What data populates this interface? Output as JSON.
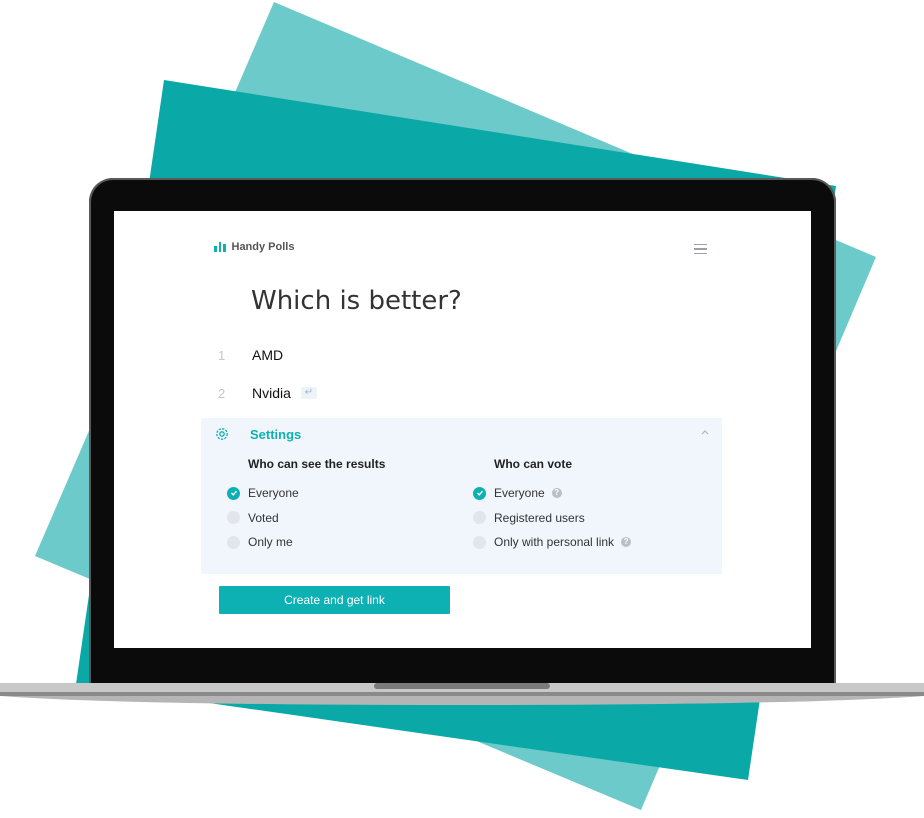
{
  "app": {
    "brand": "Handy Polls"
  },
  "poll": {
    "question": "Which is better?",
    "options": [
      {
        "number": "1",
        "label": "AMD"
      },
      {
        "number": "2",
        "label": "Nvidia"
      }
    ]
  },
  "settings": {
    "title": "Settings",
    "results": {
      "title": "Who can see the results",
      "choices": [
        "Everyone",
        "Voted",
        "Only me"
      ],
      "selected": "Everyone"
    },
    "vote": {
      "title": "Who can vote",
      "choices": [
        "Everyone",
        "Registered users",
        "Only with personal link"
      ],
      "selected": "Everyone",
      "help_glyph": "?"
    }
  },
  "actions": {
    "create_label": "Create and get link"
  },
  "colors": {
    "accent": "#0eb1b3",
    "panel": "#f1f6fc",
    "teal_dark": "#0ba8a8",
    "teal_light": "#6ccacb"
  },
  "icons": [
    "bar-chart-icon",
    "hamburger-menu-icon",
    "enter-key-icon",
    "gear-icon",
    "chevron-up-icon",
    "check-icon",
    "help-icon"
  ]
}
